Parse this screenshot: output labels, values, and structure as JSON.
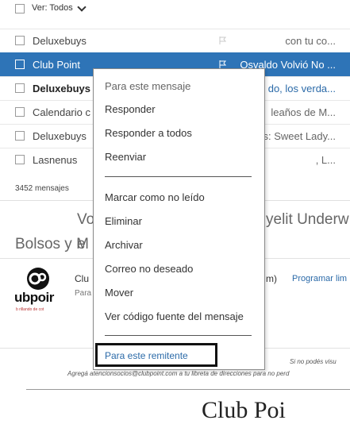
{
  "toolbar": {
    "view_filter_label": "Ver: Todos"
  },
  "messages": [
    {
      "sender": "Deluxebuys",
      "subject": "con tu co..."
    },
    {
      "sender": "Club Point",
      "subject": "Osvaldo Volvió No ..."
    },
    {
      "sender": "Deluxebuys",
      "subject": "do, los verda..."
    },
    {
      "sender": "Calendario c",
      "subject": "leaños de M..."
    },
    {
      "sender": "Deluxebuys",
      "subject": "s: Sweet Lady..."
    },
    {
      "sender": "Lasnenus",
      "subject": ", L..."
    }
  ],
  "message_count": "3452 mensajes",
  "preview": {
    "title_left": "Vo",
    "title_right": "yelit Underw",
    "subtitle_left": "Bolsos y M",
    "subtitle_right": "e",
    "sender_short": "Clu",
    "paren": "m)",
    "para_short": "Para",
    "schedule_link": "Programar lim",
    "notice": "Si no podés visu",
    "add_contact": "Agregá atencionsocios@clubpoint.com a tu libreta de direcciones para no perd",
    "brand_partial": "Club Poi",
    "logo_text": "ubpoir",
    "logo_tagline": "b rillando de cot"
  },
  "context_menu": {
    "header": "Para este mensaje",
    "items": [
      "Responder",
      "Responder a todos",
      "Reenviar",
      "Marcar como no leído",
      "Eliminar",
      "Archivar",
      "Correo no deseado",
      "Mover",
      "Ver código fuente del mensaje"
    ],
    "footer_link": "Para este remitente"
  },
  "colors": {
    "selected_row": "#2e74b7",
    "link": "#2b6aa8"
  }
}
